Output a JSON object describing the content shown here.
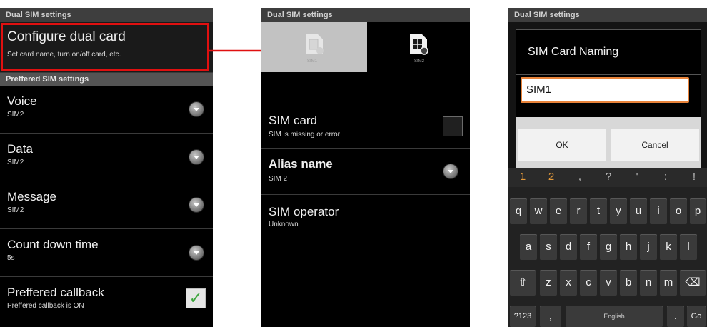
{
  "screen1": {
    "header": "Dual SIM settings",
    "configure": {
      "title": "Configure dual card",
      "subtitle": "Set card name, turn on/off card, etc."
    },
    "section": "Preffered SIM settings",
    "items": [
      {
        "title": "Voice",
        "subtitle": "SIM2"
      },
      {
        "title": "Data",
        "subtitle": "SIM2"
      },
      {
        "title": "Message",
        "subtitle": "SIM2"
      },
      {
        "title": "Count down time",
        "subtitle": "5s"
      }
    ],
    "callback": {
      "title": "Preffered callback",
      "subtitle": "Preffered callback is ON",
      "checked": true
    }
  },
  "screen2": {
    "header": "Dual SIM settings",
    "tabs": [
      {
        "label": "SIM1"
      },
      {
        "label": "SIM2"
      }
    ],
    "sim_card": {
      "title": "SIM card",
      "subtitle": "SIM is missing or error",
      "checked": false
    },
    "alias": {
      "title": "Alias name",
      "subtitle": "SIM 2"
    },
    "operator": {
      "title": "SIM operator",
      "subtitle": "Unknown"
    }
  },
  "screen3": {
    "header": "Dual SIM settings",
    "dialog": {
      "title": "SIM Card Naming",
      "value": "SIM1",
      "ok": "OK",
      "cancel": "Cancel"
    },
    "number_row": [
      "1",
      "2",
      ",",
      "?",
      "'",
      ":",
      "!"
    ],
    "row1": [
      "q",
      "w",
      "e",
      "r",
      "t",
      "y",
      "u",
      "i",
      "o",
      "p"
    ],
    "row2": [
      "a",
      "s",
      "d",
      "f",
      "g",
      "h",
      "j",
      "k",
      "l"
    ],
    "row3": [
      "z",
      "x",
      "c",
      "v",
      "b",
      "n",
      "m"
    ],
    "bottom": {
      "mode": "?123",
      "comma": ",",
      "space": "English",
      "period": ".",
      "go": "Go"
    }
  },
  "colors": {
    "highlight_border": "#e01010",
    "arrow": "#e01010",
    "check": "#3ba53b",
    "input_border": "#e8833a"
  }
}
